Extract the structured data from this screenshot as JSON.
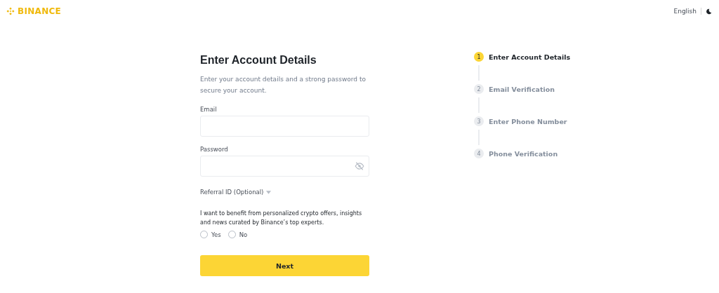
{
  "header": {
    "logo": "BINANCE",
    "language": "English"
  },
  "form": {
    "title": "Enter Account Details",
    "subtitle": "Enter your account details and a strong password to secure your account.",
    "fields": [
      {
        "label": "Email",
        "kind": "text"
      },
      {
        "label": "Password",
        "kind": "password"
      }
    ],
    "referral": {
      "label": "Referral ID (Optional)",
      "expanded": false
    },
    "consent": {
      "text": "I want to benefit from personalized crypto offers, insights and news curated by Binance’s top experts.",
      "options": [
        {
          "label": "Yes",
          "selected": false
        },
        {
          "label": "No",
          "selected": false
        }
      ]
    },
    "submit": "Next"
  },
  "steps": [
    {
      "number": "1",
      "label": "Enter Account Details",
      "selected": true
    },
    {
      "number": "2",
      "label": "Email Verification",
      "selected": false
    },
    {
      "number": "3",
      "label": "Enter Phone Number",
      "selected": false
    },
    {
      "number": "4",
      "label": "Phone Verification",
      "selected": false
    }
  ]
}
